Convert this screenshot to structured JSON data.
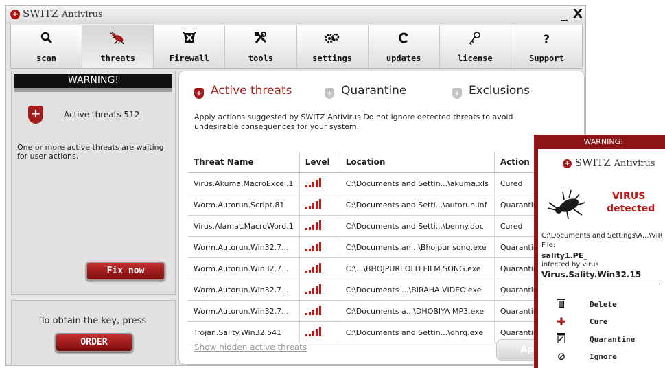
{
  "window": {
    "app_name": "SWITZ",
    "app_suffix": "Antivirus",
    "minimize": "_",
    "close": "X"
  },
  "toolbar": [
    {
      "label": "scan",
      "icon": "magnifier"
    },
    {
      "label": "threats",
      "icon": "bug"
    },
    {
      "label": "Firewall",
      "icon": "firewall"
    },
    {
      "label": "tools",
      "icon": "tools"
    },
    {
      "label": "settings",
      "icon": "gears"
    },
    {
      "label": "updates",
      "icon": "updates"
    },
    {
      "label": "license",
      "icon": "key"
    },
    {
      "label": "Support",
      "icon": "question"
    }
  ],
  "left_panel": {
    "warning": "WARNING!",
    "active_threats": "Active threats 512",
    "message": "One or more active threats are waiting for user actions.",
    "fix_button": "Fix now",
    "key_text": "To obtain the key, press",
    "order_button": "ORDER"
  },
  "tabs": {
    "active": "Active threats",
    "quarantine": "Quarantine",
    "exclusions": "Exclusions"
  },
  "apply_message": "Apply actions suggested by SWITZ Antivirus.Do not ignore detected threats to avoid undesirable consequences for your system.",
  "table": {
    "headers": {
      "name": "Threat Name",
      "level": "Level",
      "location": "Location",
      "action": "Action"
    },
    "rows": [
      {
        "name": "Virus.Akuma.MacroExcel.1",
        "level": 5,
        "location": "C:\\Documents and Settin...\\akuma.xls",
        "action": "Cured"
      },
      {
        "name": "Worm.Autorun.Script.81",
        "level": 5,
        "location": "C:\\Documents and Setti...\\autorun.inf",
        "action": "Quarantined"
      },
      {
        "name": "Virus.Alamat.MacroWord.1",
        "level": 5,
        "location": "C:\\Documents and Setti...\\benny.doc",
        "action": "Cured"
      },
      {
        "name": "Worm.Autorun.Win32.7...",
        "level": 5,
        "location": "C:\\Documents an...\\Bhojpur song.exe",
        "action": "Quarantined"
      },
      {
        "name": "Worm.Autorun.Win32.7...",
        "level": 5,
        "location": "C:\\...\\BHOJPURI OLD FILM SONG.exe",
        "action": "Quarantined"
      },
      {
        "name": "Worm.Autorun.Win32.7...",
        "level": 5,
        "location": "C:\\Documents ...\\BIRAHA VIDEO.exe",
        "action": "Quarantined"
      },
      {
        "name": "Worm.Autorun.Win32.7...",
        "level": 5,
        "location": "C:\\Documents a...\\DHOBIYA MP3.exe",
        "action": "Quarantined"
      },
      {
        "name": "Trojan.Sality.Win32.541",
        "level": 5,
        "location": "C:\\Documents and Settin...\\dhrq.exe",
        "action": "Quarantined"
      }
    ]
  },
  "show_hidden": "Show hidden active threats",
  "apply_button": "Apply",
  "popup": {
    "header": "WARNING!",
    "app_name": "SWITZ",
    "app_suffix": "Antivirus",
    "virus": "VIRUS",
    "detected": "detected",
    "path": "C:\\Documents and Settings\\A...\\VIR",
    "file_label": "File:",
    "file_name": "sality1.PE_",
    "infected_by": "infected by virus",
    "virus_name": "Virus.Sality.Win32.15",
    "actions": {
      "delete": "Delete",
      "cure": "Cure",
      "quarantine": "Quarantine",
      "ignore": "Ignore"
    }
  },
  "colors": {
    "brand_red": "#a51a1a",
    "level_red": "#cc1111",
    "popup_border": "#8e1515"
  }
}
